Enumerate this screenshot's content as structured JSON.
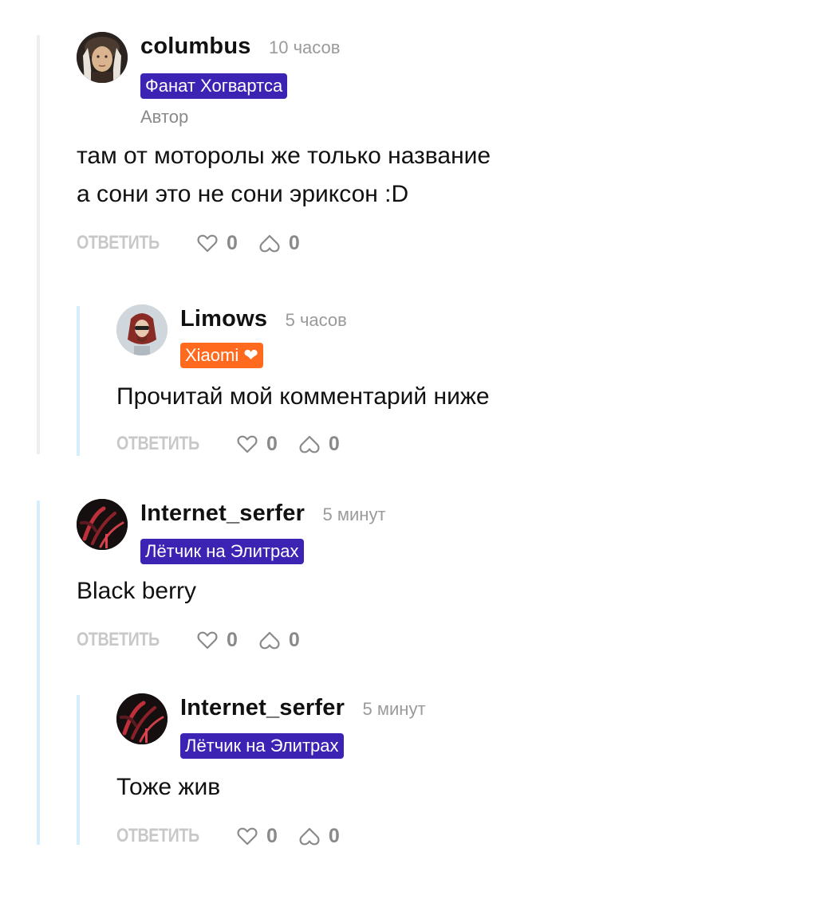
{
  "comments": [
    {
      "author": "columbus",
      "time": "10 часов",
      "badge": "Фанат Хогвартса",
      "role": "Автор",
      "text_lines": [
        "там от моторолы же только название",
        "а сони это не сони эриксон :D"
      ],
      "reply_label": "ОТВЕТИТЬ",
      "likes": "0",
      "dislikes": "0"
    },
    {
      "author": "Limows",
      "time": "5 часов",
      "badge": "Xiaomi ❤",
      "text_lines": [
        "Прочитай мой комментарий ниже"
      ],
      "reply_label": "ОТВЕТИТЬ",
      "likes": "0",
      "dislikes": "0"
    },
    {
      "author": "Internet_serfer",
      "time": "5 минут",
      "badge": "Лётчик на Элитрах",
      "text_lines": [
        "Black berry"
      ],
      "reply_label": "ОТВЕТИТЬ",
      "likes": "0",
      "dislikes": "0"
    },
    {
      "author": "Internet_serfer",
      "time": "5 минут",
      "badge": "Лётчик на Элитрах",
      "text_lines": [
        "Тоже жив"
      ],
      "reply_label": "ОТВЕТИТЬ",
      "likes": "0",
      "dislikes": "0"
    }
  ],
  "icons": {
    "like": "heart-icon",
    "dislike": "broken-heart-icon"
  },
  "colors": {
    "badge_purple": "#3d23b3",
    "badge_orange": "#ff6a1f",
    "thread_grey": "#eeeeee",
    "thread_blue": "#d6eef9"
  }
}
